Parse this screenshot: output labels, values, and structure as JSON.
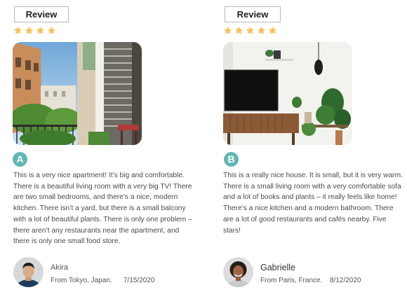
{
  "reviews": [
    {
      "button_label": "Review",
      "rating": 4,
      "badge": "A",
      "photo": "balcony-street-photo",
      "text": "This is a very nice apartment! It’s big and comfortable. There is a beautiful living room with a very big TV! There are two small bedrooms, and there’s a nice, modern kitchen. There isn’t a yard, but there is a small balcony with a lot of beautiful plants. There is only one problem – there aren’t any restaurants near the apartment, and there is only one small food store.",
      "author": "Akira",
      "location": "From Tokyo, Japan.",
      "date": "7/15/2020",
      "avatar": "man-avatar"
    },
    {
      "button_label": "Review",
      "rating": 5,
      "badge": "B",
      "photo": "living-room-photo",
      "text": "This is a really nice house. It is small, but it is very warm. There is a small living room with a very comfortable sofa and a lot of books and plants – it really feels like home! There’s a nice kitchen and a modern bathroom. There are a lot of good restaurants and cafés nearby. Five stars!",
      "author": "Gabrielle",
      "location": "From Paris, France.",
      "date": "8/12/2020",
      "avatar": "woman-avatar"
    }
  ],
  "colors": {
    "star": "#f6c260",
    "badge": "#63b7b2",
    "button_border": "#b9b9b9",
    "text": "#4a4a4a"
  }
}
